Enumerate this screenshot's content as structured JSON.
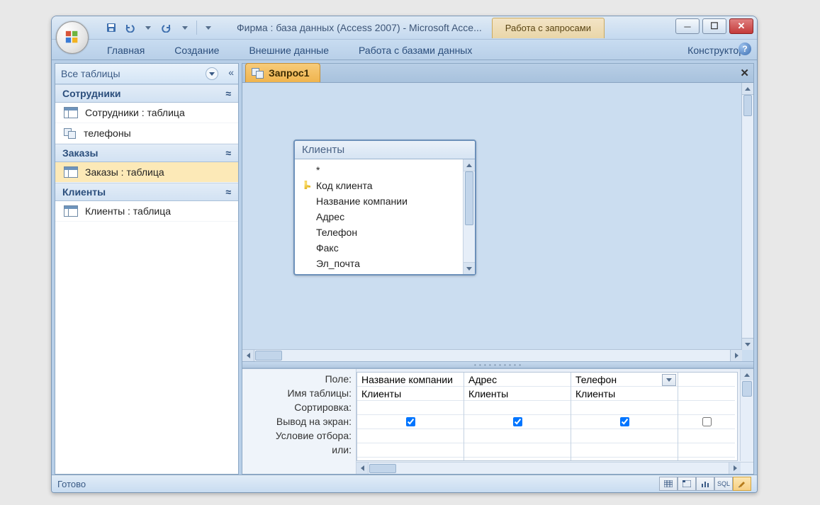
{
  "window": {
    "title": "Фирма : база данных (Access 2007)  -  Microsoft Acce...",
    "context_title": "Работа с запросами"
  },
  "ribbon": {
    "tabs": [
      "Главная",
      "Создание",
      "Внешние данные",
      "Работа с базами данных"
    ],
    "context_tab": "Конструктор"
  },
  "nav": {
    "header": "Все таблицы",
    "groups": [
      {
        "title": "Сотрудники",
        "items": [
          {
            "label": "Сотрудники : таблица",
            "icon": "table"
          },
          {
            "label": "телефоны",
            "icon": "query"
          }
        ]
      },
      {
        "title": "Заказы",
        "items": [
          {
            "label": "Заказы : таблица",
            "icon": "table",
            "selected": true
          }
        ]
      },
      {
        "title": "Клиенты",
        "items": [
          {
            "label": "Клиенты : таблица",
            "icon": "table"
          }
        ]
      }
    ]
  },
  "doc": {
    "tab": "Запрос1"
  },
  "table_box": {
    "title": "Клиенты",
    "fields": [
      "*",
      "Код клиента",
      "Название компании",
      "Адрес",
      "Телефон",
      "Факс",
      "Эл_почта"
    ],
    "key_index": 1
  },
  "grid": {
    "labels": [
      "Поле:",
      "Имя таблицы:",
      "Сортировка:",
      "Вывод на экран:",
      "Условие отбора:",
      "или:"
    ],
    "columns": [
      {
        "field": "Название компании",
        "table": "Клиенты",
        "sort": "",
        "show": true,
        "criteria": "",
        "or": ""
      },
      {
        "field": "Адрес",
        "table": "Клиенты",
        "sort": "",
        "show": true,
        "criteria": "",
        "or": ""
      },
      {
        "field": "Телефон",
        "table": "Клиенты",
        "sort": "",
        "show": true,
        "criteria": "",
        "or": "",
        "selected": true
      }
    ]
  },
  "status": {
    "text": "Готово",
    "views": [
      "datasheet",
      "pivot-table",
      "pivot-chart",
      "sql",
      "design"
    ],
    "sql_label": "SQL"
  }
}
